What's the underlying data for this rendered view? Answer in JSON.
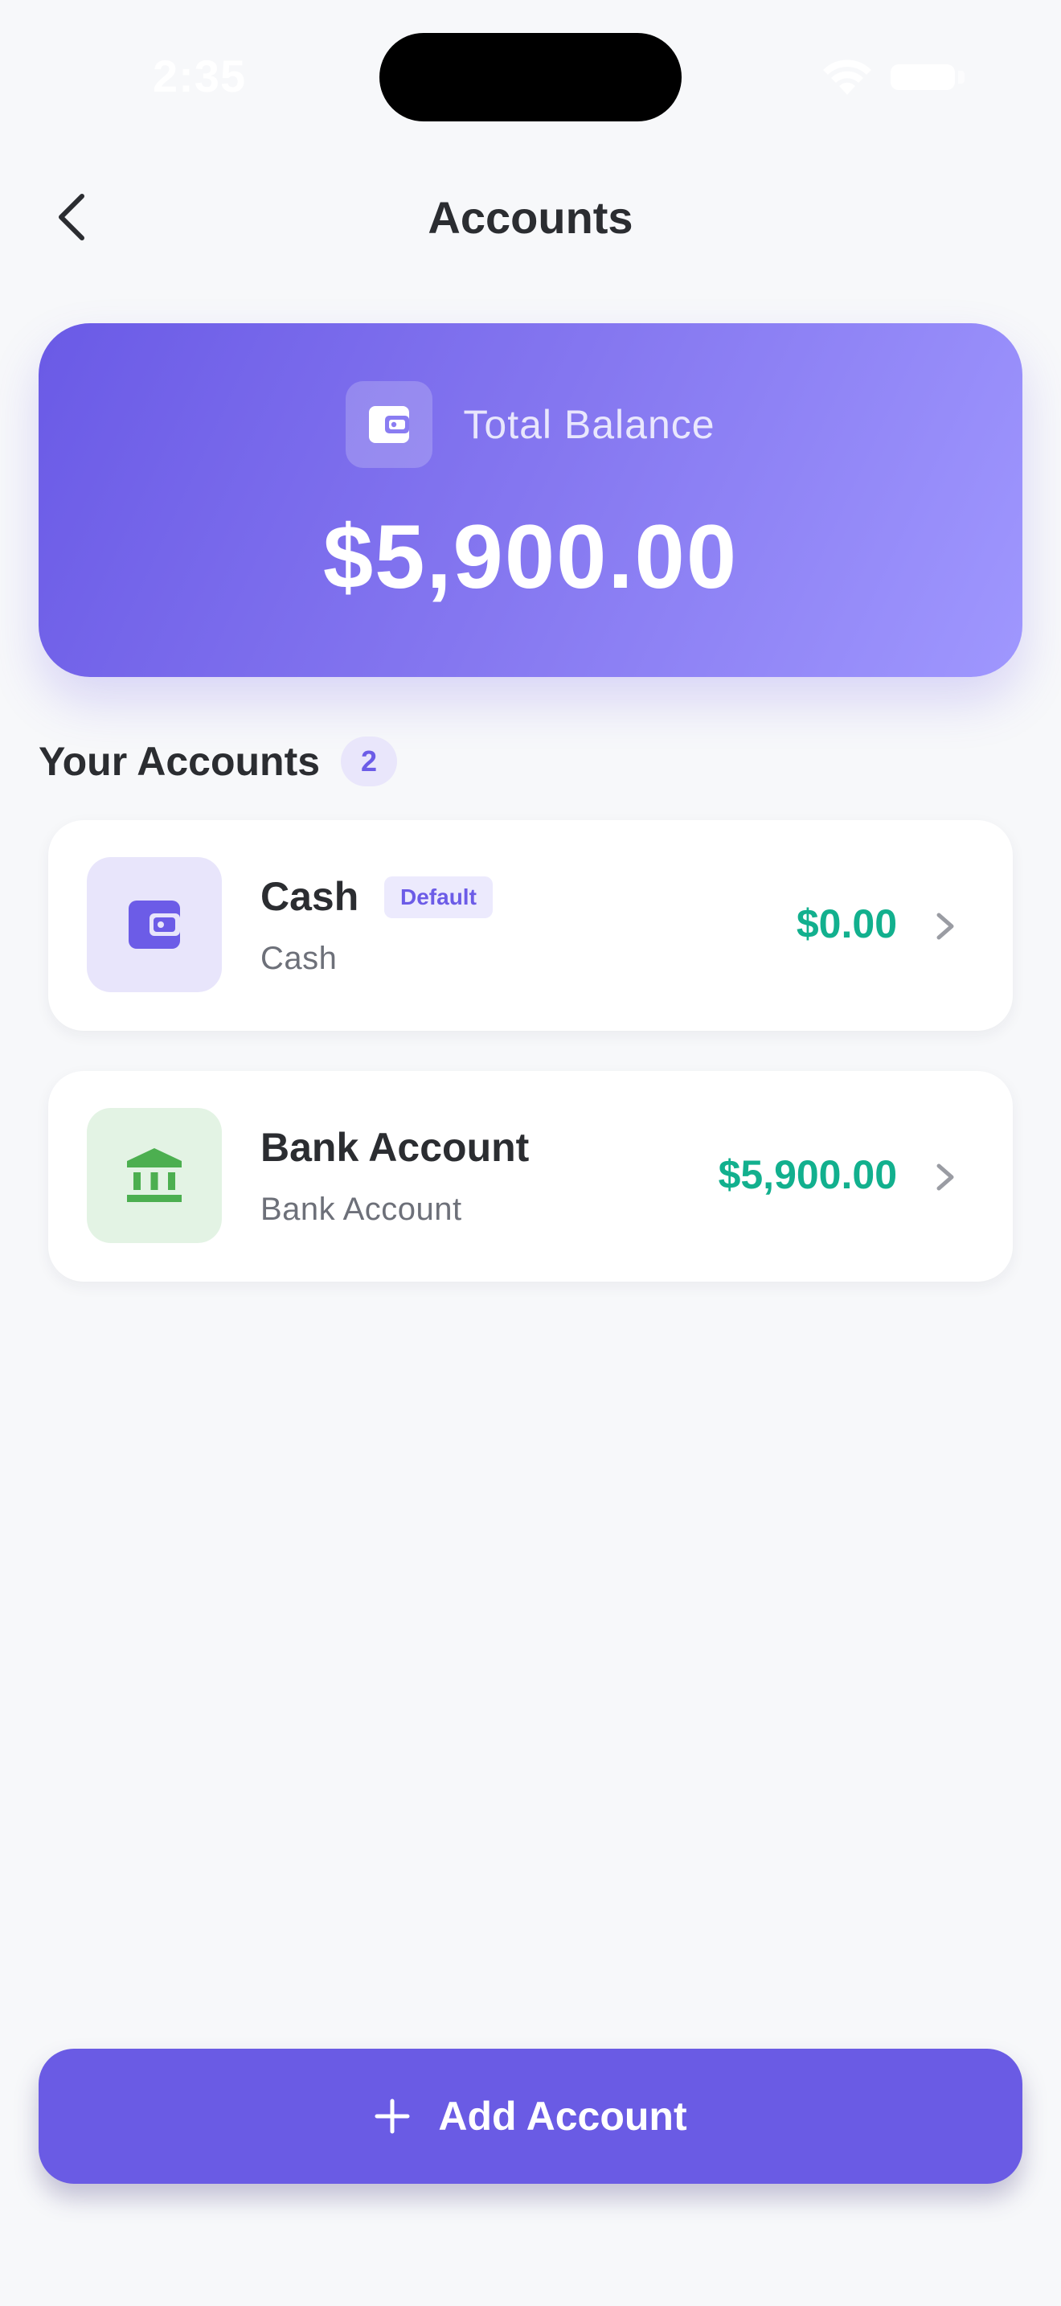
{
  "status_bar": {
    "time": "2:35"
  },
  "nav": {
    "title": "Accounts"
  },
  "balance": {
    "label": "Total Balance",
    "amount": "$5,900.00"
  },
  "section": {
    "title": "Your Accounts",
    "count": "2"
  },
  "accounts": [
    {
      "name": "Cash",
      "badge": "Default",
      "type": "Cash",
      "amount": "$0.00",
      "icon": "wallet-icon"
    },
    {
      "name": "Bank Account",
      "type": "Bank Account",
      "amount": "$5,900.00",
      "icon": "bank-icon"
    }
  ],
  "footer": {
    "add_label": "Add Account"
  },
  "colors": {
    "accent": "#6c5ce7",
    "positive": "#12b08e",
    "bank_green": "#4caf50"
  }
}
